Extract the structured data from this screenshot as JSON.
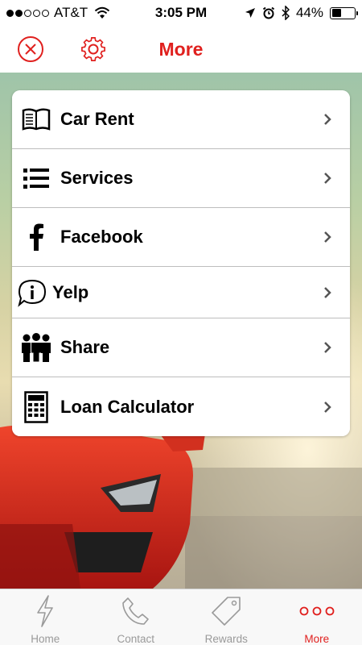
{
  "status_bar": {
    "carrier": "AT&T",
    "time": "3:05 PM",
    "battery": "44%",
    "battery_level": 0.44,
    "signal_bars": 2
  },
  "header": {
    "title": "More",
    "close_icon": "close-circle-icon",
    "settings_icon": "gear-icon"
  },
  "menu": {
    "items": [
      {
        "label": "Car Rent",
        "icon": "book-icon"
      },
      {
        "label": "Services",
        "icon": "list-icon"
      },
      {
        "label": "Facebook",
        "icon": "facebook-icon"
      },
      {
        "label": "Yelp",
        "icon": "info-bubble-icon"
      },
      {
        "label": "Share",
        "icon": "people-icon"
      },
      {
        "label": "Loan Calculator",
        "icon": "calculator-icon"
      }
    ]
  },
  "tabs": [
    {
      "label": "Home",
      "icon": "lightning-icon",
      "active": false
    },
    {
      "label": "Contact",
      "icon": "phone-icon",
      "active": false
    },
    {
      "label": "Rewards",
      "icon": "tag-icon",
      "active": false
    },
    {
      "label": "More",
      "icon": "more-dots-icon",
      "active": true
    }
  ],
  "colors": {
    "accent": "#e0201e",
    "tab_inactive": "#9a9a9a",
    "separator": "#bdbdbd"
  }
}
